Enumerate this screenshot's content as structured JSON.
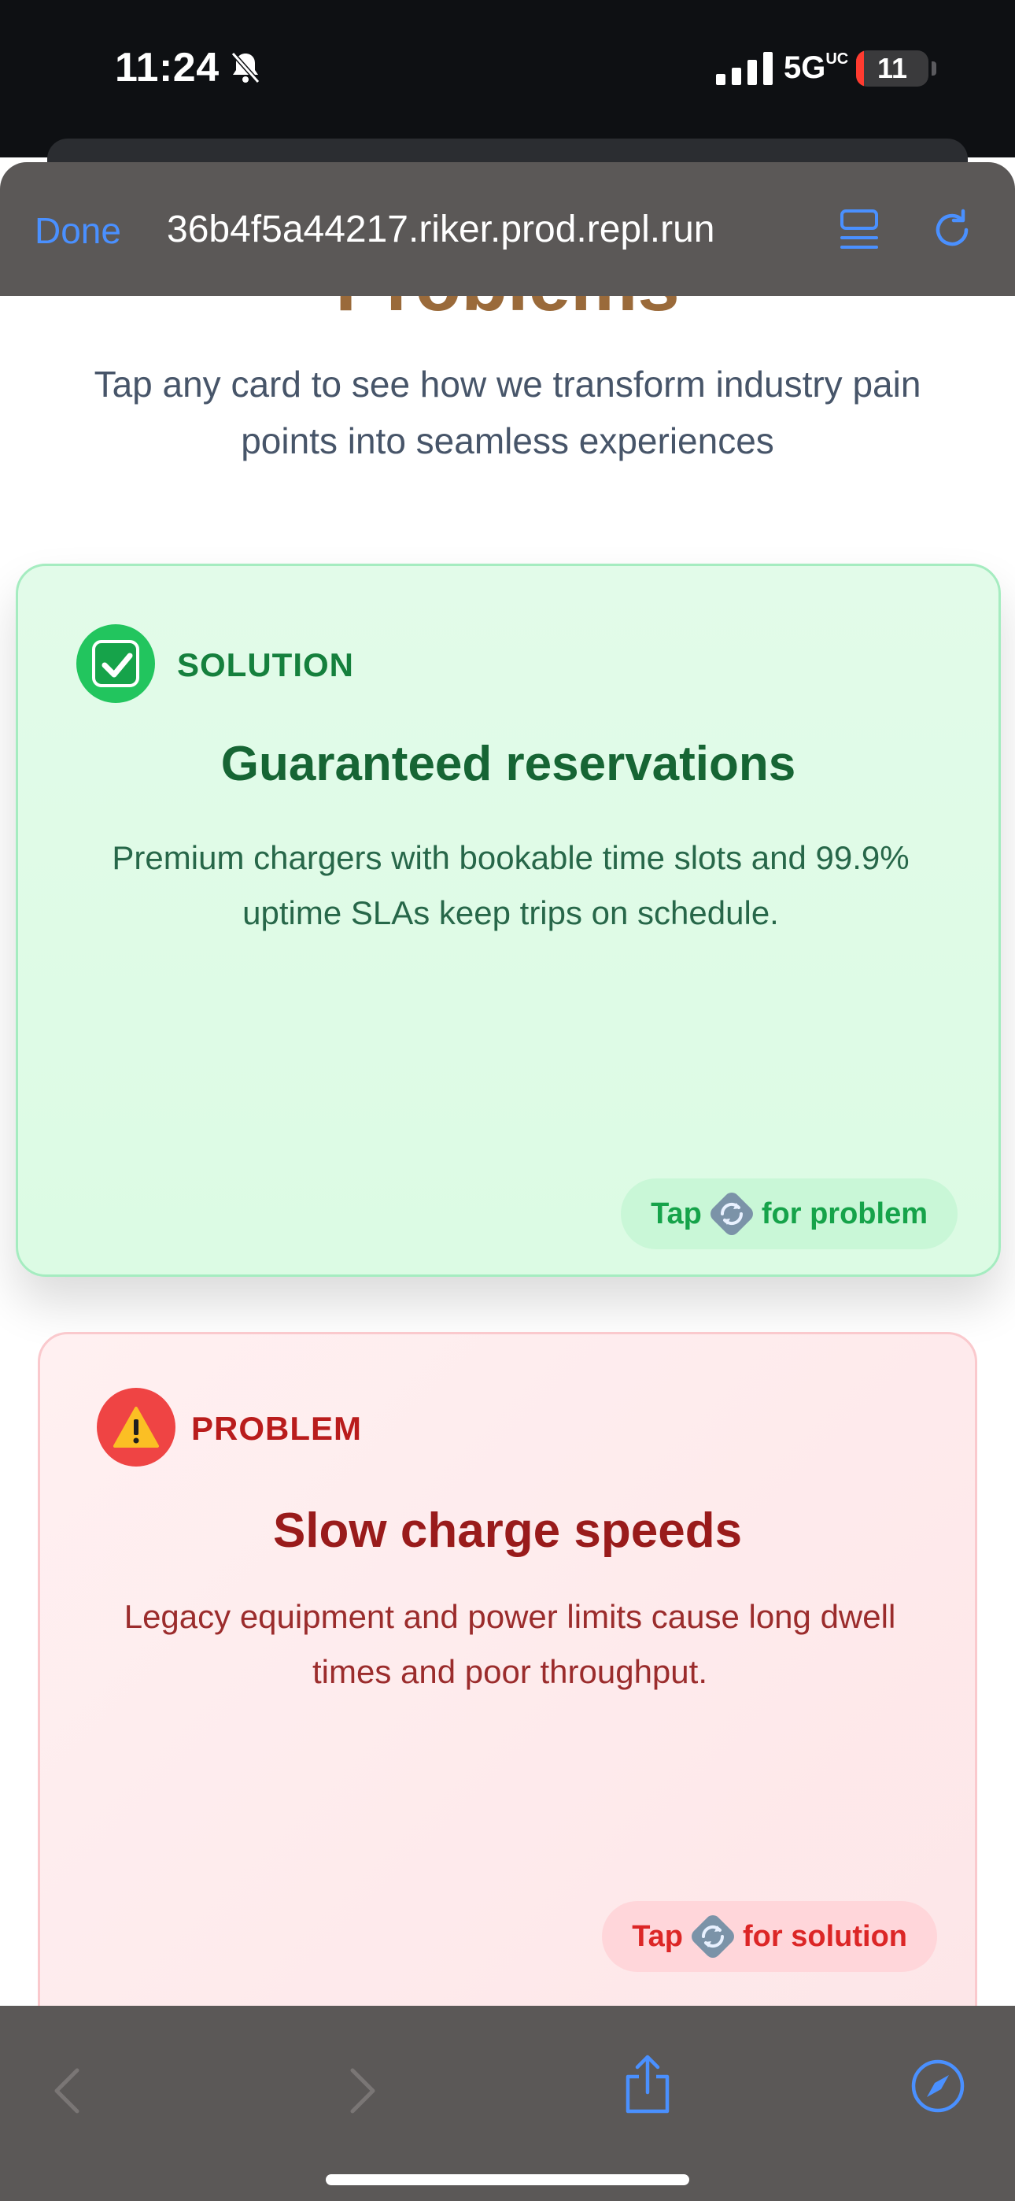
{
  "status_bar": {
    "time": "11:24",
    "network": "5G",
    "network_suffix": "UC",
    "battery_level": "11",
    "battery_fraction": 0.11,
    "icons": [
      "bell-slash-icon",
      "signal-icon",
      "battery-icon"
    ]
  },
  "browser": {
    "done_label": "Done",
    "url": "36b4f5a44217.riker.prod.repl.run",
    "icons": [
      "reader-icon",
      "reload-icon"
    ]
  },
  "page": {
    "heading_partial": "Problems",
    "subtitle": "Tap any card to see how we transform industry pain points into seamless experiences",
    "cards": [
      {
        "kind": "solution",
        "badge_label": "SOLUTION",
        "badge_icon": "check-mark-icon",
        "title": "Guaranteed reservations",
        "description": "Premium chargers with bookable time slots and 99.9% uptime SLAs keep trips on schedule.",
        "tap_prefix": "Tap",
        "tap_suffix": "for problem",
        "accent": "#16a34a"
      },
      {
        "kind": "problem",
        "badge_label": "PROBLEM",
        "badge_icon": "warning-icon",
        "title": "Slow charge speeds",
        "description": "Legacy equipment and power limits cause long dwell times and poor throughput.",
        "tap_prefix": "Tap",
        "tap_suffix": "for solution",
        "accent": "#dc2626"
      }
    ]
  },
  "toolbar": {
    "icons": [
      "back-icon",
      "forward-icon",
      "share-icon",
      "safari-compass-icon"
    ]
  }
}
